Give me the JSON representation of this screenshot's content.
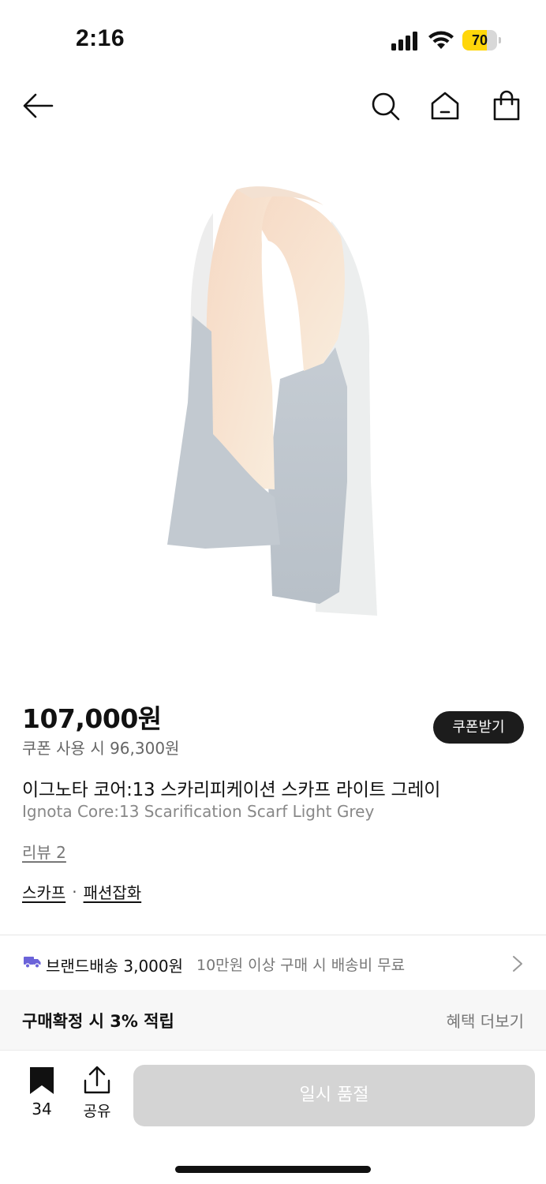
{
  "status_bar": {
    "time": "2:16",
    "battery_level": "70",
    "battery_fraction": 0.7,
    "battery_color": "#ffd60a"
  },
  "nav": {
    "back_icon": "arrow-left-icon",
    "search_icon": "search-icon",
    "home_icon": "home-icon",
    "bag_icon": "shopping-bag-icon"
  },
  "product": {
    "price": "107,000원",
    "coupon_price": "쿠폰 사용 시 96,300원",
    "coupon_button": "쿠폰받기",
    "title_ko": "이그노타 코어:13 스카리피케이션 스카프 라이트 그레이",
    "title_en": "Ignota Core:13 Scarification Scarf Light Grey",
    "review": "리뷰 2",
    "categories": [
      "스카프",
      "패션잡화"
    ],
    "category_separator": "·"
  },
  "shipping": {
    "icon": "truck-icon",
    "icon_color": "#6b63d9",
    "label": "브랜드배송 3,000원",
    "note": "10만원 이상 구매 시 배송비 무료"
  },
  "reward": {
    "label": "구매확정 시 3% 적립",
    "more": "혜택 더보기"
  },
  "bottom_bar": {
    "bookmark_count": "34",
    "share_label": "공유",
    "soldout_label": "일시 품절",
    "button_color": "#d4d4d4"
  }
}
